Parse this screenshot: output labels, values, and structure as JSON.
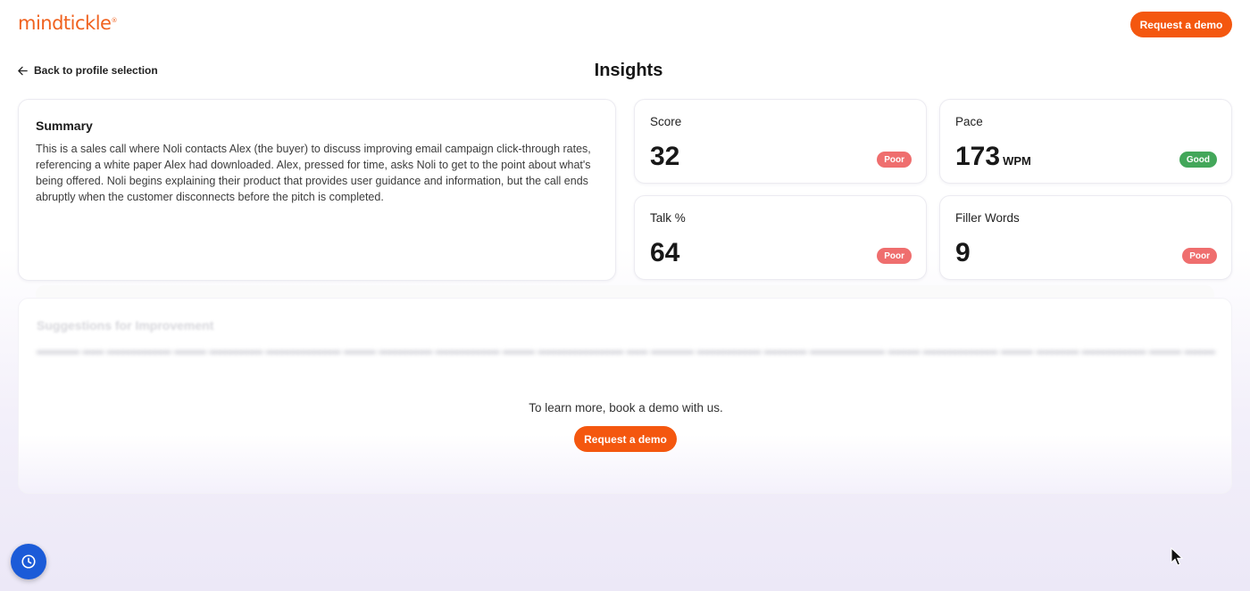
{
  "brand": {
    "logo_text": "mindtickle",
    "logo_mark": "®",
    "accent": "#f4570f"
  },
  "header": {
    "request_demo_label": "Request a demo"
  },
  "nav": {
    "back_label": "Back to profile selection"
  },
  "page": {
    "title": "Insights"
  },
  "summary": {
    "heading": "Summary",
    "text": "This is a sales call where Noli contacts Alex (the buyer) to discuss improving email campaign click-through rates, referencing a white paper Alex had downloaded. Alex, pressed for time, asks Noli to get to the point about what's being offered. Noli begins explaining their product that provides user guidance and information, but the call ends abruptly when the customer disconnects before the pitch is completed."
  },
  "metrics": [
    {
      "label": "Score",
      "value": "32",
      "unit": "",
      "badge": "Poor",
      "badge_status": "poor"
    },
    {
      "label": "Pace",
      "value": "173",
      "unit": "WPM",
      "badge": "Good",
      "badge_status": "good"
    },
    {
      "label": "Talk %",
      "value": "64",
      "unit": "",
      "badge": "Poor",
      "badge_status": "poor"
    },
    {
      "label": "Filler Words",
      "value": "9",
      "unit": "",
      "badge": "Poor",
      "badge_status": "poor"
    }
  ],
  "status_colors": {
    "poor": "#ef6e6e",
    "good": "#43a75a"
  },
  "suggestions": {
    "heading": "Suggestions for Improvement",
    "cta_text": "To learn more, book a demo with us.",
    "cta_button_label": "Request a demo"
  },
  "icons": {
    "back": "arrow-left-icon",
    "history": "clock-icon",
    "cursor": "mouse-pointer-icon"
  }
}
